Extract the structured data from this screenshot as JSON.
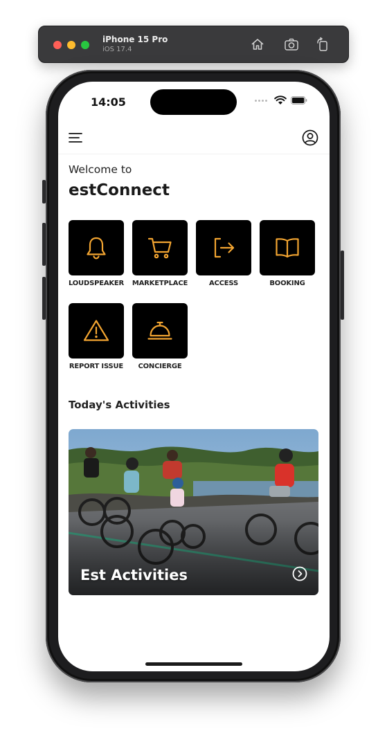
{
  "simulator": {
    "device_name": "iPhone 15 Pro",
    "os_version": "iOS 17.4",
    "buttons": {
      "home": "home-icon",
      "screenshot": "camera-icon",
      "rotate": "rotate-icon"
    }
  },
  "status_bar": {
    "time": "14:05"
  },
  "header": {
    "menu_icon": "menu-icon",
    "profile_icon": "profile-icon"
  },
  "welcome": {
    "greeting": "Welcome to",
    "app_name": "estConnect"
  },
  "tiles": [
    {
      "label": "LOUDSPEAKER",
      "icon": "bell-icon"
    },
    {
      "label": "MARKETPLACE",
      "icon": "cart-icon"
    },
    {
      "label": "ACCESS",
      "icon": "login-icon"
    },
    {
      "label": "BOOKING",
      "icon": "book-icon"
    },
    {
      "label": "REPORT ISSUE",
      "icon": "warning-icon"
    },
    {
      "label": "CONCIERGE",
      "icon": "service-bell-icon"
    }
  ],
  "activities": {
    "section_title": "Today's Activities",
    "card": {
      "title": "Est Activities",
      "icon": "chevron-right-circle-icon"
    }
  },
  "colors": {
    "accent": "#f3a531",
    "tile_bg": "#000000"
  }
}
